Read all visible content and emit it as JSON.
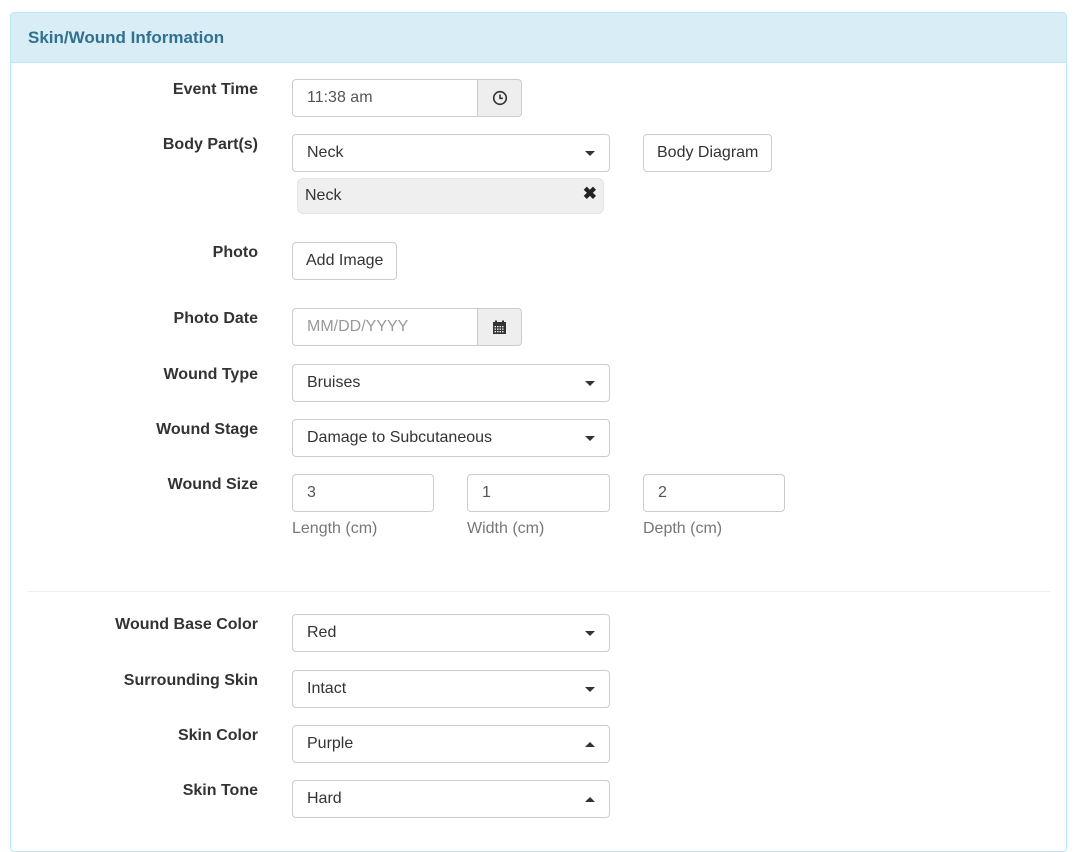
{
  "panel": {
    "title": "Skin/Wound Information"
  },
  "fields": {
    "event_time": {
      "label": "Event Time",
      "value": "11:38 am",
      "icon": "clock-icon"
    },
    "body_parts": {
      "label": "Body Part(s)",
      "selected": "Neck",
      "chips": [
        {
          "label": "Neck",
          "remove_icon": "close-icon"
        }
      ],
      "diagram_button": "Body Diagram"
    },
    "photo": {
      "label": "Photo",
      "button": "Add Image"
    },
    "photo_date": {
      "label": "Photo Date",
      "placeholder": "MM/DD/YYYY",
      "value": "",
      "icon": "calendar-icon"
    },
    "wound_type": {
      "label": "Wound Type",
      "value": "Bruises"
    },
    "wound_stage": {
      "label": "Wound Stage",
      "value": "Damage to Subcutaneous"
    },
    "wound_size": {
      "label": "Wound Size",
      "length": {
        "value": "3",
        "help": "Length (cm)"
      },
      "width": {
        "value": "1",
        "help": "Width (cm)"
      },
      "depth": {
        "value": "2",
        "help": "Depth (cm)"
      }
    },
    "wound_base_color": {
      "label": "Wound Base Color",
      "value": "Red"
    },
    "surrounding_skin": {
      "label": "Surrounding Skin",
      "value": "Intact"
    },
    "skin_color": {
      "label": "Skin Color",
      "value": "Purple"
    },
    "skin_tone": {
      "label": "Skin Tone",
      "value": "Hard"
    }
  },
  "colors": {
    "header_bg": "#d9edf7",
    "header_text": "#31708f",
    "border": "#bce8f1"
  }
}
